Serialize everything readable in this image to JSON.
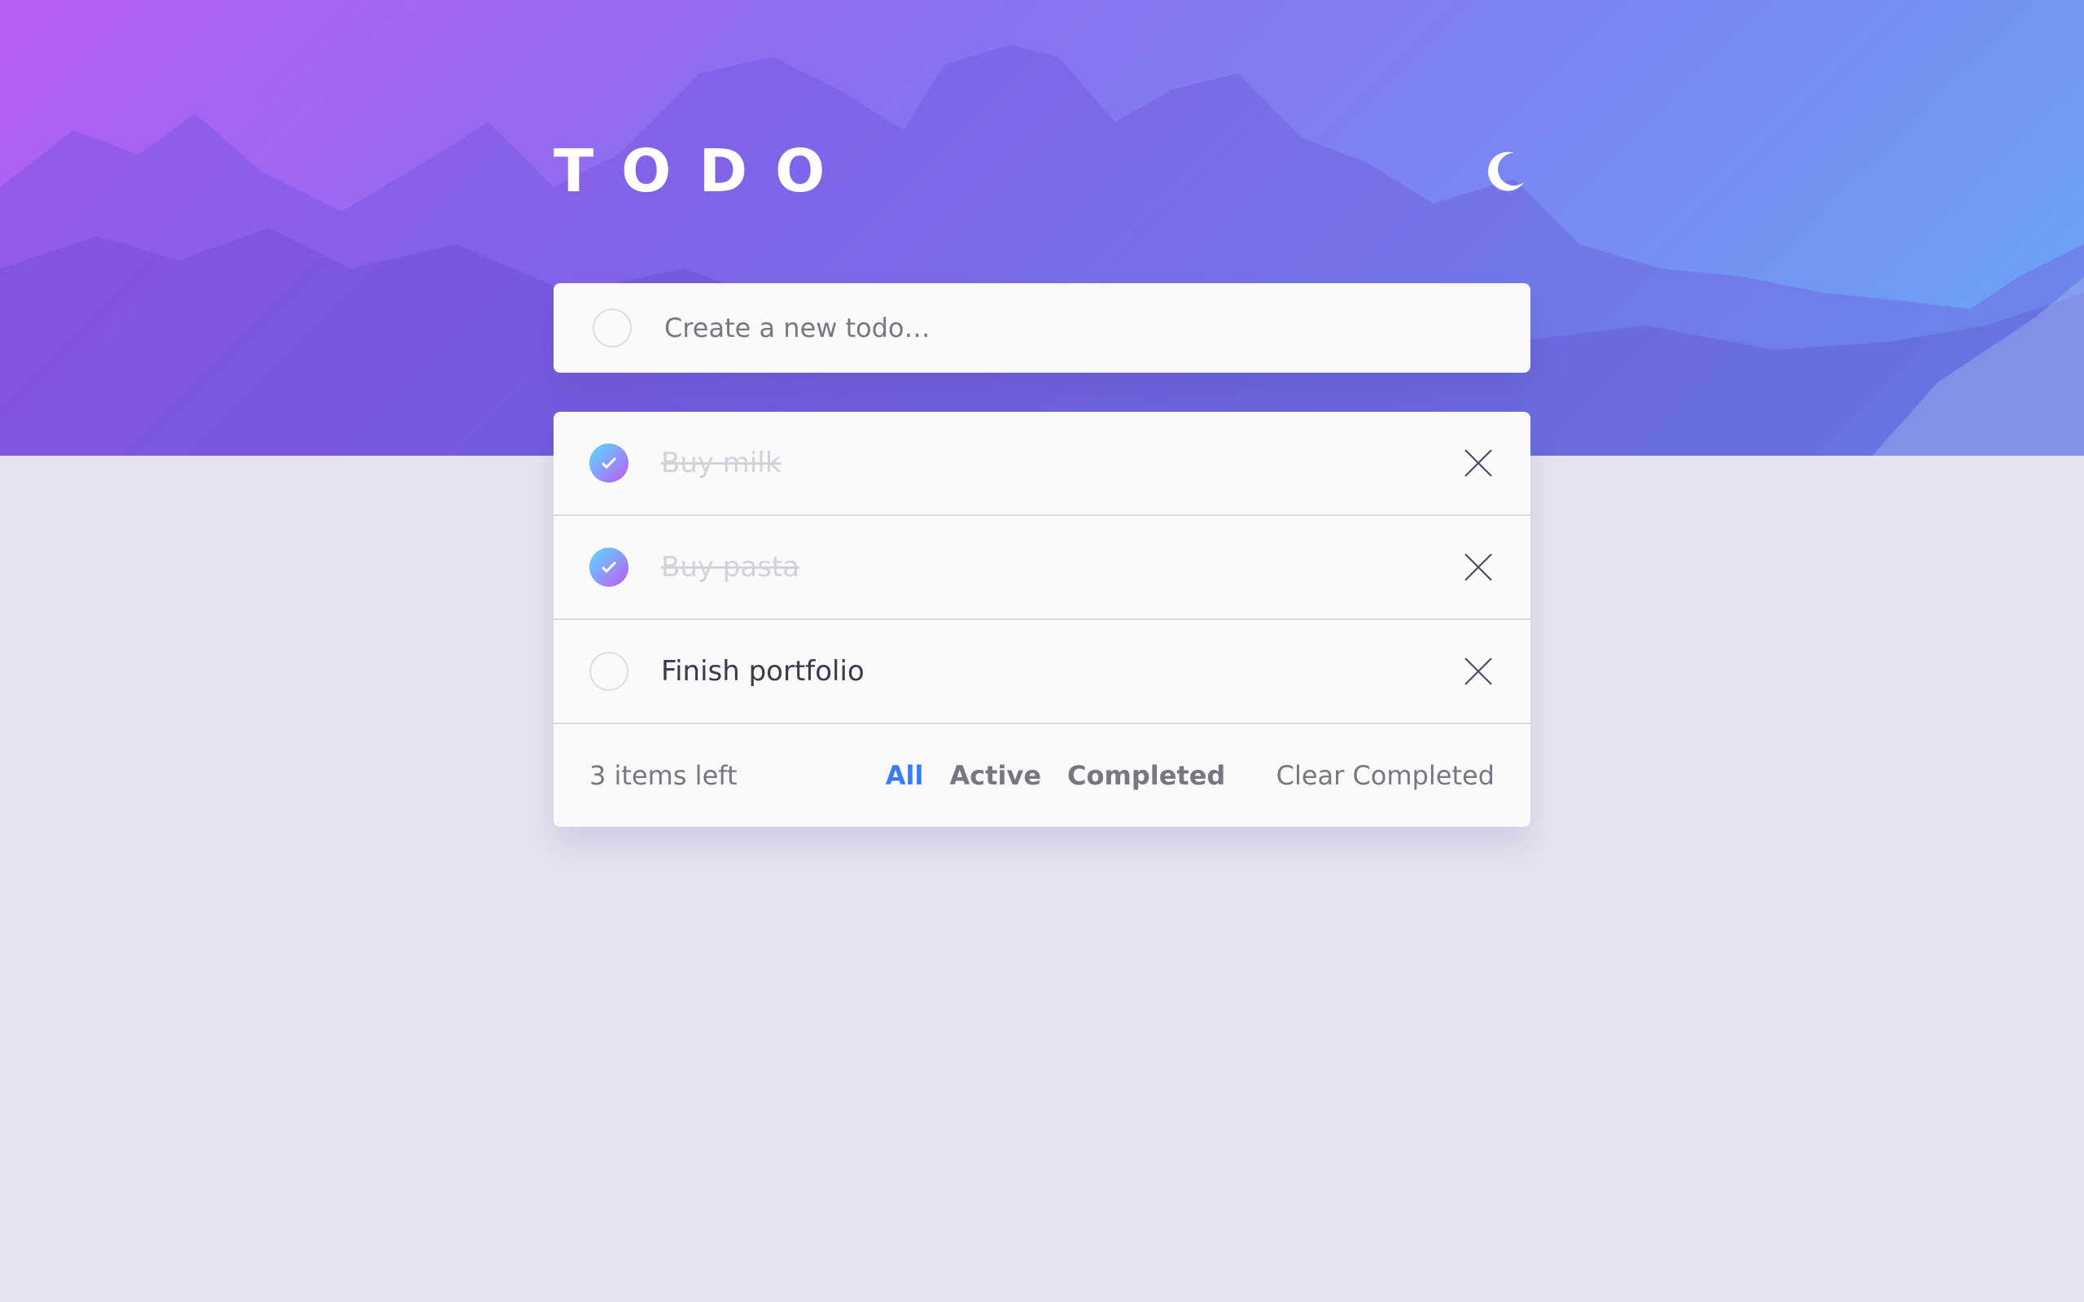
{
  "app": {
    "title": "TODO",
    "accent": "#3a7bfd",
    "gradient": [
      "#57ddff",
      "#c058f3"
    ]
  },
  "header": {
    "theme_icon": "moon-icon"
  },
  "new_todo": {
    "placeholder": "Create a new todo…"
  },
  "todos": [
    {
      "label": "Buy milk",
      "completed": true
    },
    {
      "label": "Buy pasta",
      "completed": true
    },
    {
      "label": "Finish portfolio",
      "completed": false
    }
  ],
  "footer": {
    "items_left": "3 items left",
    "filters": [
      "All",
      "Active",
      "Completed"
    ],
    "active_filter": "All",
    "clear_label": "Clear Completed"
  }
}
